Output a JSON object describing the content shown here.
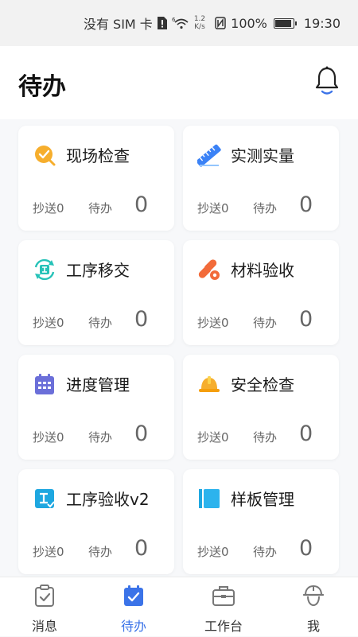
{
  "status_bar": {
    "carrier": "没有 SIM 卡",
    "speed_value": "1.2",
    "speed_unit": "K/s",
    "battery": "100%",
    "time": "19:30"
  },
  "header": {
    "title": "待办"
  },
  "cards": [
    {
      "name": "现场检查",
      "cc_label": "抄送0",
      "pending_label": "待办",
      "pending_count": "0",
      "icon": "site-inspection-icon"
    },
    {
      "name": "实测实量",
      "cc_label": "抄送0",
      "pending_label": "待办",
      "pending_count": "0",
      "icon": "ruler-icon"
    },
    {
      "name": "工序移交",
      "cc_label": "抄送0",
      "pending_label": "待办",
      "pending_count": "0",
      "icon": "process-handover-icon"
    },
    {
      "name": "材料验收",
      "cc_label": "抄送0",
      "pending_label": "待办",
      "pending_count": "0",
      "icon": "materials-icon"
    },
    {
      "name": "进度管理",
      "cc_label": "抄送0",
      "pending_label": "待办",
      "pending_count": "0",
      "icon": "calendar-icon"
    },
    {
      "name": "安全检查",
      "cc_label": "抄送0",
      "pending_label": "待办",
      "pending_count": "0",
      "icon": "hardhat-icon"
    },
    {
      "name": "工序验收v2",
      "cc_label": "抄送0",
      "pending_label": "待办",
      "pending_count": "0",
      "icon": "process-acceptance-icon"
    },
    {
      "name": "样板管理",
      "cc_label": "抄送0",
      "pending_label": "待办",
      "pending_count": "0",
      "icon": "sample-board-icon"
    }
  ],
  "tabs": [
    {
      "label": "消息",
      "icon": "clipboard-check-icon"
    },
    {
      "label": "待办",
      "icon": "calendar-check-icon",
      "active": true
    },
    {
      "label": "工作台",
      "icon": "briefcase-icon"
    },
    {
      "label": "我",
      "icon": "hardhat-profile-icon"
    }
  ],
  "colors": {
    "accent": "#3b73e8",
    "page_bg": "#f7f8fa",
    "card_bg": "#ffffff",
    "muted_text": "#666666"
  }
}
